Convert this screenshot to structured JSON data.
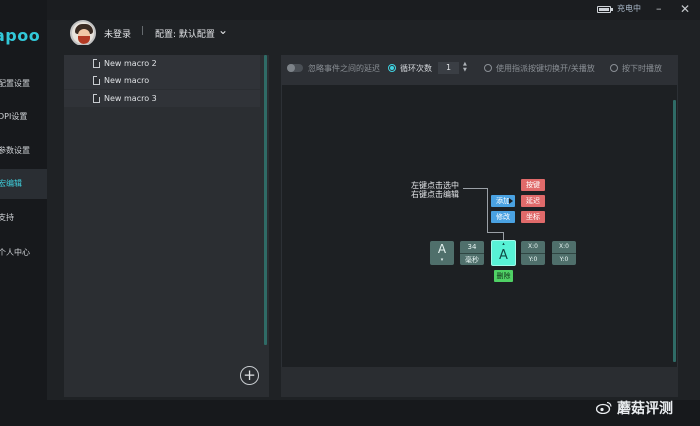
{
  "titlebar": {
    "battery_level": 0.8,
    "charging_label": "充电中",
    "minimize_glyph": "–",
    "close_glyph": "✕"
  },
  "brand": {
    "logo_text": "apoo"
  },
  "nav": {
    "items": [
      {
        "label": "配置设置",
        "icon": "settings-icon",
        "active": false
      },
      {
        "label": "DPI设置",
        "icon": "dpi-icon",
        "active": false
      },
      {
        "label": "参数设置",
        "icon": "params-icon",
        "active": false
      },
      {
        "label": "宏编辑",
        "icon": "macro-icon",
        "active": true
      },
      {
        "label": "支持",
        "icon": "support-icon",
        "active": false
      },
      {
        "label": "个人中心",
        "icon": "user-icon",
        "active": false
      }
    ]
  },
  "header": {
    "login_label": "未登录",
    "separator": "|",
    "config_label": "配置: 默认配置",
    "chevron": "⌄"
  },
  "macro_list": {
    "items": [
      {
        "name": "New macro 2"
      },
      {
        "name": "New macro"
      },
      {
        "name": "New macro 3"
      }
    ],
    "add_glyph": "+"
  },
  "options": {
    "ignore_delay_label": "忽略事件之间的延迟",
    "loop_count_label": "循环次数",
    "loop_count_value": "1",
    "toggle_run_label": "使用指派按键切换开/关播放",
    "hold_run_label": "按下时播放",
    "selected_mode": "loop"
  },
  "editor": {
    "hint_left_click": "左键点击选中",
    "hint_right_click": "右键点击编辑",
    "menu": {
      "add": "添加",
      "modify": "修改",
      "delete": "删除",
      "keyboard": "按键",
      "delay": "延迟",
      "coordinate": "坐标"
    },
    "events": [
      {
        "kind": "key",
        "key": "A",
        "direction": "down"
      },
      {
        "kind": "delay",
        "value": "34",
        "unit": "毫秒"
      },
      {
        "kind": "key",
        "key": "A",
        "direction": "up",
        "selected": true
      },
      {
        "kind": "move",
        "x_label": "X:0",
        "y_label": "Y:0"
      },
      {
        "kind": "move",
        "x_label": "X:0",
        "y_label": "Y:0"
      }
    ],
    "down_arrow": "▾",
    "up_arrow": "▴"
  },
  "watermark": {
    "text": "蘑菇评测",
    "icon": "weibo-icon"
  },
  "colors": {
    "accent": "#40d3e1",
    "selected_key": "#58f2d6",
    "add_chip": "#4aa2e2",
    "red_chip": "#e06a6a",
    "delete_chip": "#4fd165"
  }
}
